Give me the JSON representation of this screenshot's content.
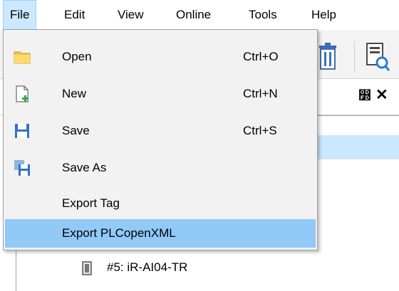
{
  "menubar": {
    "items": [
      {
        "label": "File",
        "active": true
      },
      {
        "label": "Edit"
      },
      {
        "label": "View"
      },
      {
        "label": "Online"
      },
      {
        "label": "Tools"
      },
      {
        "label": "Help"
      }
    ]
  },
  "file_menu": {
    "items": [
      {
        "label": "Open",
        "shortcut": "Ctrl+O",
        "icon": "folder-icon"
      },
      {
        "label": "New",
        "shortcut": "Ctrl+N",
        "icon": "new-file-icon"
      },
      {
        "label": "Save",
        "shortcut": "Ctrl+S",
        "icon": "floppy-disk-icon"
      },
      {
        "label": "Save As",
        "shortcut": "",
        "icon": "save-as-icon"
      },
      {
        "label": "Export Tag",
        "shortcut": ""
      },
      {
        "label": "Export PLCopenXML",
        "shortcut": "",
        "highlighted": true
      }
    ]
  },
  "panel": {
    "pin_glyph": "෽",
    "close_glyph": "✕"
  },
  "tree": {
    "items": [
      {
        "label": "#5: iR-AI04-TR",
        "icon": "module-icon"
      }
    ]
  },
  "colors": {
    "menu_bg": "#f2f2f2",
    "highlight": "#91c9f7",
    "active_menu": "#cce8ff"
  }
}
